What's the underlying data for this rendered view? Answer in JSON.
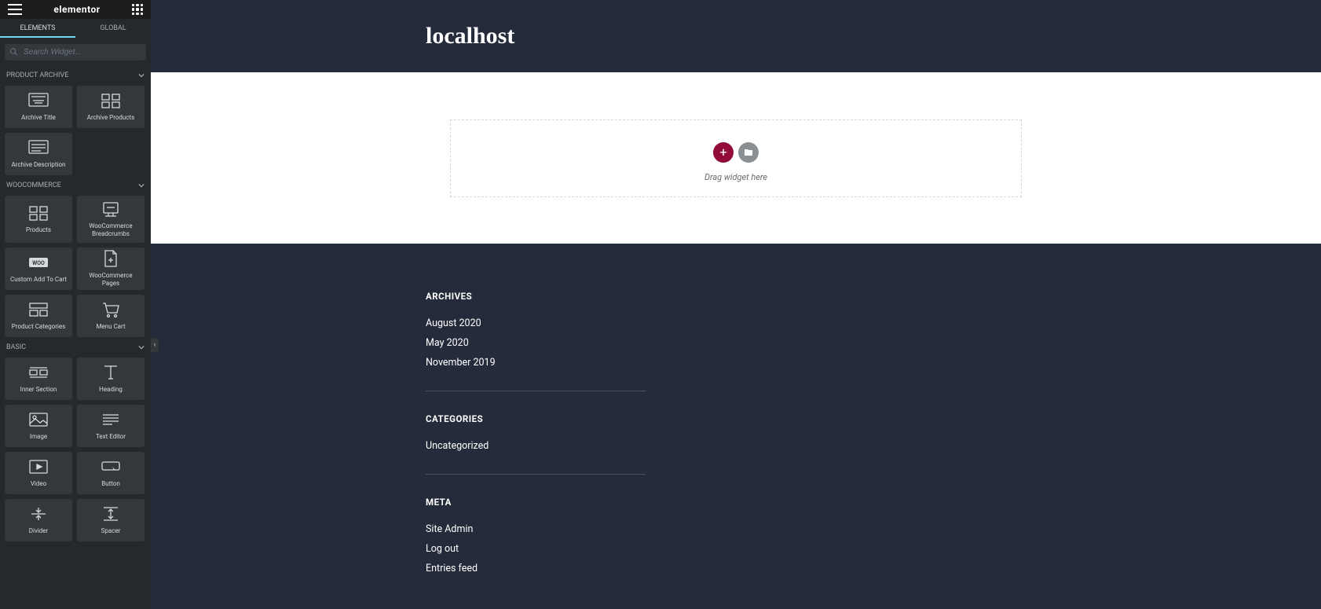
{
  "header": {
    "logo": "elementor"
  },
  "tabs": {
    "elements": "ELEMENTS",
    "global": "GLOBAL"
  },
  "search": {
    "placeholder": "Search Widget..."
  },
  "categories": [
    {
      "title": "PRODUCT ARCHIVE",
      "widgets": [
        {
          "label": "Archive Title",
          "icon": "archive-title"
        },
        {
          "label": "Archive Products",
          "icon": "archive-products"
        },
        {
          "label": "Archive Description",
          "icon": "archive-description"
        }
      ]
    },
    {
      "title": "WOOCOMMERCE",
      "widgets": [
        {
          "label": "Products",
          "icon": "products"
        },
        {
          "label": "WooCommerce Breadcrumbs",
          "icon": "breadcrumbs"
        },
        {
          "label": "Custom Add To Cart",
          "icon": "add-to-cart"
        },
        {
          "label": "WooCommerce Pages",
          "icon": "woo-pages"
        },
        {
          "label": "Product Categories",
          "icon": "prod-cats"
        },
        {
          "label": "Menu Cart",
          "icon": "menu-cart"
        }
      ]
    },
    {
      "title": "BASIC",
      "widgets": [
        {
          "label": "Inner Section",
          "icon": "inner-section"
        },
        {
          "label": "Heading",
          "icon": "heading"
        },
        {
          "label": "Image",
          "icon": "image"
        },
        {
          "label": "Text Editor",
          "icon": "text-editor"
        },
        {
          "label": "Video",
          "icon": "video"
        },
        {
          "label": "Button",
          "icon": "button"
        },
        {
          "label": "Divider",
          "icon": "divider"
        },
        {
          "label": "Spacer",
          "icon": "spacer"
        }
      ]
    }
  ],
  "preview": {
    "title": "localhost",
    "dropzone_text": "Drag widget here"
  },
  "footer": {
    "archives": {
      "title": "ARCHIVES",
      "items": [
        "August 2020",
        "May 2020",
        "November 2019"
      ]
    },
    "categories": {
      "title": "CATEGORIES",
      "items": [
        "Uncategorized"
      ]
    },
    "meta": {
      "title": "META",
      "items": [
        "Site Admin",
        "Log out",
        "Entries feed"
      ]
    }
  },
  "icons": {
    "chevron_down": "▾"
  }
}
